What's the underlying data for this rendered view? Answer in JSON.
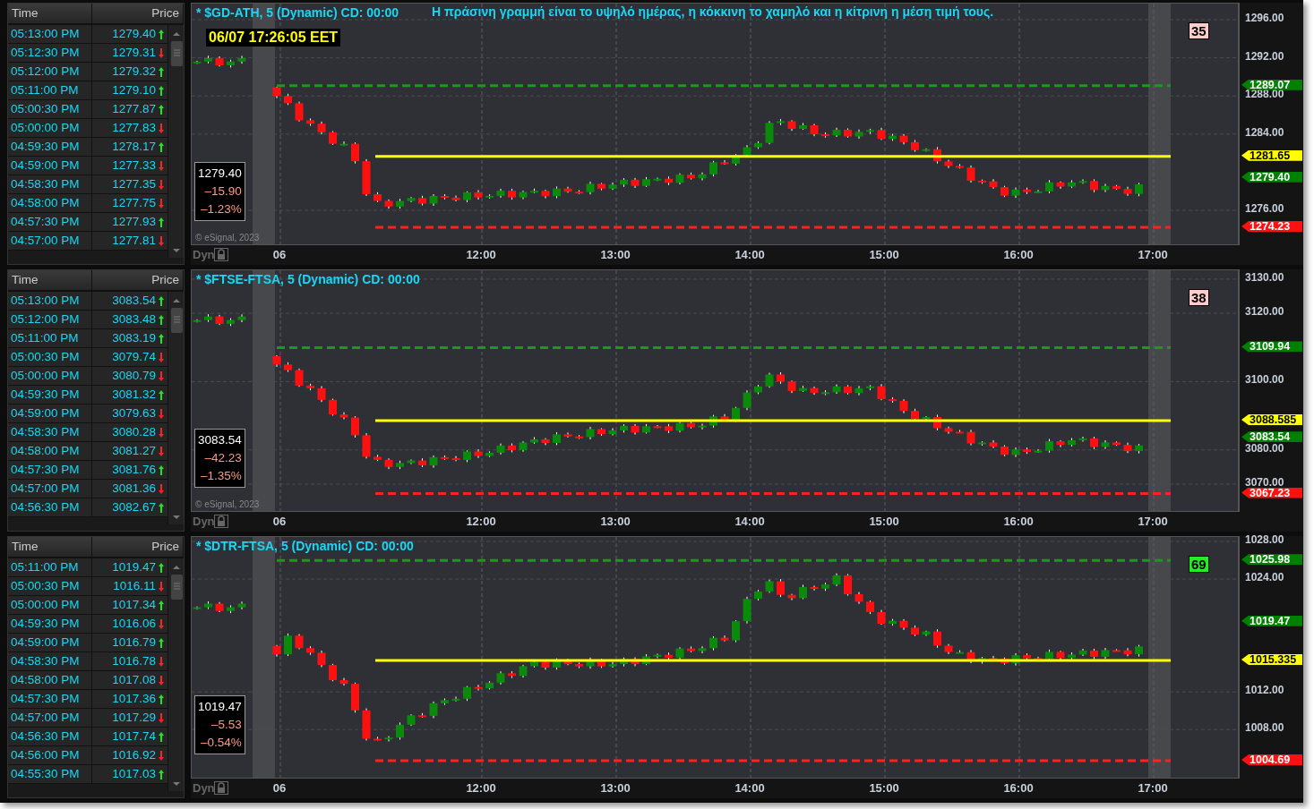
{
  "panes": [
    {
      "title": "* $GD-ATH, 5 (Dynamic) CD: 00:00",
      "date_label": "06/07 17:26:05 EET",
      "note": "Η πράσινη γραμμή είναι το υψηλό ημέρας, η κόκκινη το χαμηλό και η κίτρινη η μέση τιμή τους.",
      "badge": {
        "text": "35",
        "color": "#ffcccc"
      },
      "info": {
        "last": "1279.40",
        "change": "–15.90",
        "percent": "–1.23%"
      },
      "copyright": "© eSignal, 2023",
      "dyn_label": "Dyn",
      "y_ticks": [
        "1296.00",
        "1292.00",
        "1288.00",
        "1284.00",
        "1276.00"
      ],
      "x_ticks": [
        {
          "label": "06",
          "kind": "day"
        },
        {
          "label": "12:00",
          "kind": "hour"
        },
        {
          "label": "13:00",
          "kind": "hour"
        },
        {
          "label": "14:00",
          "kind": "hour"
        },
        {
          "label": "15:00",
          "kind": "hour"
        },
        {
          "label": "16:00",
          "kind": "hour"
        },
        {
          "label": "17:00",
          "kind": "hour"
        }
      ],
      "markers": [
        {
          "kind": "high",
          "label": "1289.07"
        },
        {
          "kind": "mid",
          "label": "1281.65"
        },
        {
          "kind": "last",
          "label": "1279.40"
        },
        {
          "kind": "low",
          "label": "1274.23"
        }
      ],
      "table": {
        "columns": [
          "Time",
          "Price"
        ],
        "rows": [
          {
            "time": "05:13:00 PM",
            "price": "1279.40",
            "up": true
          },
          {
            "time": "05:12:30 PM",
            "price": "1279.31",
            "up": false
          },
          {
            "time": "05:12:00 PM",
            "price": "1279.32",
            "up": true
          },
          {
            "time": "05:11:00 PM",
            "price": "1279.10",
            "up": true
          },
          {
            "time": "05:00:30 PM",
            "price": "1277.87",
            "up": true
          },
          {
            "time": "05:00:00 PM",
            "price": "1277.83",
            "up": false
          },
          {
            "time": "04:59:30 PM",
            "price": "1278.17",
            "up": true
          },
          {
            "time": "04:59:00 PM",
            "price": "1277.33",
            "up": false
          },
          {
            "time": "04:58:30 PM",
            "price": "1277.35",
            "up": false
          },
          {
            "time": "04:58:00 PM",
            "price": "1277.75",
            "up": false
          },
          {
            "time": "04:57:30 PM",
            "price": "1277.93",
            "up": true
          },
          {
            "time": "04:57:00 PM",
            "price": "1277.81",
            "up": false
          }
        ]
      }
    },
    {
      "title": "* $FTSE-FTSA, 5 (Dynamic) CD: 00:00",
      "badge": {
        "text": "38",
        "color": "#ffcccc"
      },
      "info": {
        "last": "3083.54",
        "change": "–42.23",
        "percent": "–1.35%"
      },
      "copyright": "© eSignal, 2023",
      "dyn_label": "Dyn",
      "y_ticks": [
        "3130.00",
        "3120.00",
        "3100.00",
        "3080.00",
        "3070.00"
      ],
      "x_ticks": [
        {
          "label": "06",
          "kind": "day"
        },
        {
          "label": "12:00",
          "kind": "hour"
        },
        {
          "label": "13:00",
          "kind": "hour"
        },
        {
          "label": "14:00",
          "kind": "hour"
        },
        {
          "label": "15:00",
          "kind": "hour"
        },
        {
          "label": "16:00",
          "kind": "hour"
        },
        {
          "label": "17:00",
          "kind": "hour"
        }
      ],
      "markers": [
        {
          "kind": "high",
          "label": "3109.94"
        },
        {
          "kind": "mid",
          "label": "3088.585"
        },
        {
          "kind": "last",
          "label": "3083.54"
        },
        {
          "kind": "low",
          "label": "3067.23"
        }
      ],
      "table": {
        "columns": [
          "Time",
          "Price"
        ],
        "rows": [
          {
            "time": "05:13:00 PM",
            "price": "3083.54",
            "up": true
          },
          {
            "time": "05:12:00 PM",
            "price": "3083.48",
            "up": true
          },
          {
            "time": "05:11:00 PM",
            "price": "3083.19",
            "up": true
          },
          {
            "time": "05:00:30 PM",
            "price": "3079.74",
            "up": false
          },
          {
            "time": "05:00:00 PM",
            "price": "3080.79",
            "up": false
          },
          {
            "time": "04:59:30 PM",
            "price": "3081.32",
            "up": true
          },
          {
            "time": "04:59:00 PM",
            "price": "3079.63",
            "up": false
          },
          {
            "time": "04:58:30 PM",
            "price": "3080.28",
            "up": false
          },
          {
            "time": "04:58:00 PM",
            "price": "3081.27",
            "up": false
          },
          {
            "time": "04:57:30 PM",
            "price": "3081.76",
            "up": true
          },
          {
            "time": "04:57:00 PM",
            "price": "3081.36",
            "up": false
          },
          {
            "time": "04:56:30 PM",
            "price": "3082.67",
            "up": true
          }
        ]
      }
    },
    {
      "title": "* $DTR-FTSA, 5 (Dynamic) CD: 00:00",
      "badge": {
        "text": "69",
        "color": "#22ee22"
      },
      "info": {
        "last": "1019.47",
        "change": "–5.53",
        "percent": "–0.54%"
      },
      "dyn_label": "Dyn",
      "y_ticks": [
        "1028.00",
        "1024.00",
        "1012.00",
        "1008.00"
      ],
      "x_ticks": [
        {
          "label": "06",
          "kind": "day"
        },
        {
          "label": "12:00",
          "kind": "hour"
        },
        {
          "label": "13:00",
          "kind": "hour"
        },
        {
          "label": "14:00",
          "kind": "hour"
        },
        {
          "label": "15:00",
          "kind": "hour"
        },
        {
          "label": "16:00",
          "kind": "hour"
        },
        {
          "label": "17:00",
          "kind": "hour"
        }
      ],
      "markers": [
        {
          "kind": "high",
          "label": "1025.98"
        },
        {
          "kind": "last",
          "label": "1019.47"
        },
        {
          "kind": "mid",
          "label": "1015.335"
        },
        {
          "kind": "low",
          "label": "1004.69"
        }
      ],
      "table": {
        "columns": [
          "Time",
          "Price"
        ],
        "rows": [
          {
            "time": "05:11:00 PM",
            "price": "1019.47",
            "up": true
          },
          {
            "time": "05:00:30 PM",
            "price": "1016.11",
            "up": false
          },
          {
            "time": "05:00:00 PM",
            "price": "1017.34",
            "up": true
          },
          {
            "time": "04:59:30 PM",
            "price": "1016.06",
            "up": false
          },
          {
            "time": "04:59:00 PM",
            "price": "1016.79",
            "up": true
          },
          {
            "time": "04:58:30 PM",
            "price": "1016.78",
            "up": false
          },
          {
            "time": "04:58:00 PM",
            "price": "1017.08",
            "up": false
          },
          {
            "time": "04:57:30 PM",
            "price": "1017.36",
            "up": true
          },
          {
            "time": "04:57:00 PM",
            "price": "1017.29",
            "up": false
          },
          {
            "time": "04:56:30 PM",
            "price": "1017.74",
            "up": true
          },
          {
            "time": "04:56:00 PM",
            "price": "1016.92",
            "up": false
          },
          {
            "time": "04:55:30 PM",
            "price": "1017.03",
            "up": true
          }
        ]
      }
    }
  ]
}
